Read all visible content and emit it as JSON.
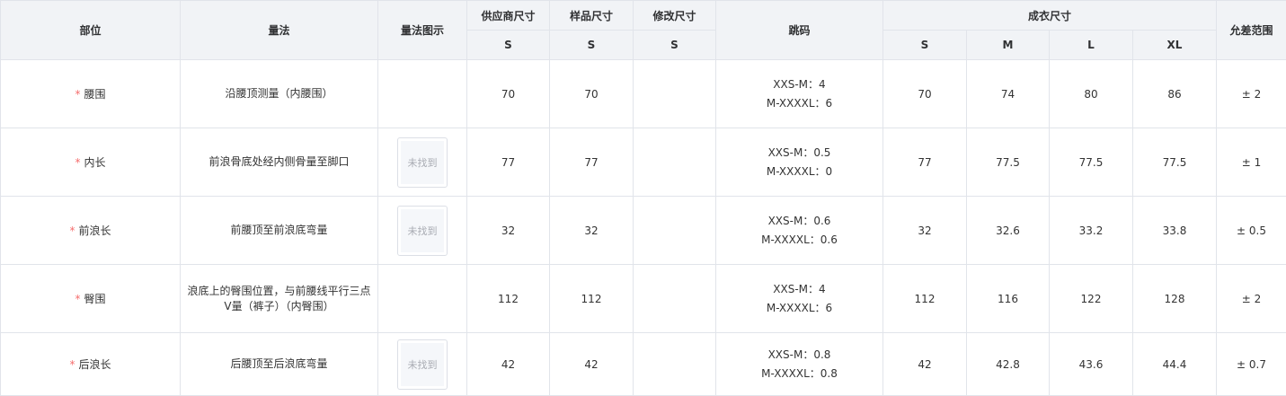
{
  "headers": {
    "part": "部位",
    "method": "量法",
    "diagram": "量法图示",
    "supplier": "供应商尺寸",
    "sample": "样品尺寸",
    "modify": "修改尺寸",
    "jump": "跳码",
    "finished": "成衣尺寸",
    "tolerance": "允差范围",
    "supplier_size": "S",
    "sample_size": "S",
    "modify_size": "S",
    "finished_sizes": [
      "S",
      "M",
      "L",
      "XL"
    ]
  },
  "rows": [
    {
      "part": "腰围",
      "required": "*",
      "method": "沿腰顶测量（内腰围）",
      "has_image": false,
      "image_text": "",
      "supplier": "70",
      "sample": "70",
      "modify": "",
      "jump": [
        "XXS-M：4",
        "M-XXXXL：6"
      ],
      "finished": [
        "70",
        "74",
        "80",
        "86"
      ],
      "tolerance": "± 2"
    },
    {
      "part": "内长",
      "required": "*",
      "method": "前浪骨底处经内侧骨量至脚口",
      "has_image": true,
      "image_text": "未找到",
      "supplier": "77",
      "sample": "77",
      "modify": "",
      "jump": [
        "XXS-M：0.5",
        "M-XXXXL：0"
      ],
      "finished": [
        "77",
        "77.5",
        "77.5",
        "77.5"
      ],
      "tolerance": "± 1"
    },
    {
      "part": "前浪长",
      "required": "*",
      "method": "前腰顶至前浪底弯量",
      "has_image": true,
      "image_text": "未找到",
      "supplier": "32",
      "sample": "32",
      "modify": "",
      "jump": [
        "XXS-M：0.6",
        "M-XXXXL：0.6"
      ],
      "finished": [
        "32",
        "32.6",
        "33.2",
        "33.8"
      ],
      "tolerance": "± 0.5"
    },
    {
      "part": "臀围",
      "required": "*",
      "method": "浪底上的臀围位置，与前腰线平行三点V量（裤子）（内臀围）",
      "has_image": false,
      "image_text": "",
      "supplier": "112",
      "sample": "112",
      "modify": "",
      "jump": [
        "XXS-M：4",
        "M-XXXXL：6"
      ],
      "finished": [
        "112",
        "116",
        "122",
        "128"
      ],
      "tolerance": "± 2"
    },
    {
      "part": "后浪长",
      "required": "*",
      "method": "后腰顶至后浪底弯量",
      "has_image": true,
      "image_text": "未找到",
      "supplier": "42",
      "sample": "42",
      "modify": "",
      "jump": [
        "XXS-M：0.8",
        "M-XXXXL：0.8"
      ],
      "finished": [
        "42",
        "42.8",
        "43.6",
        "44.4"
      ],
      "tolerance": "± 0.7"
    }
  ]
}
